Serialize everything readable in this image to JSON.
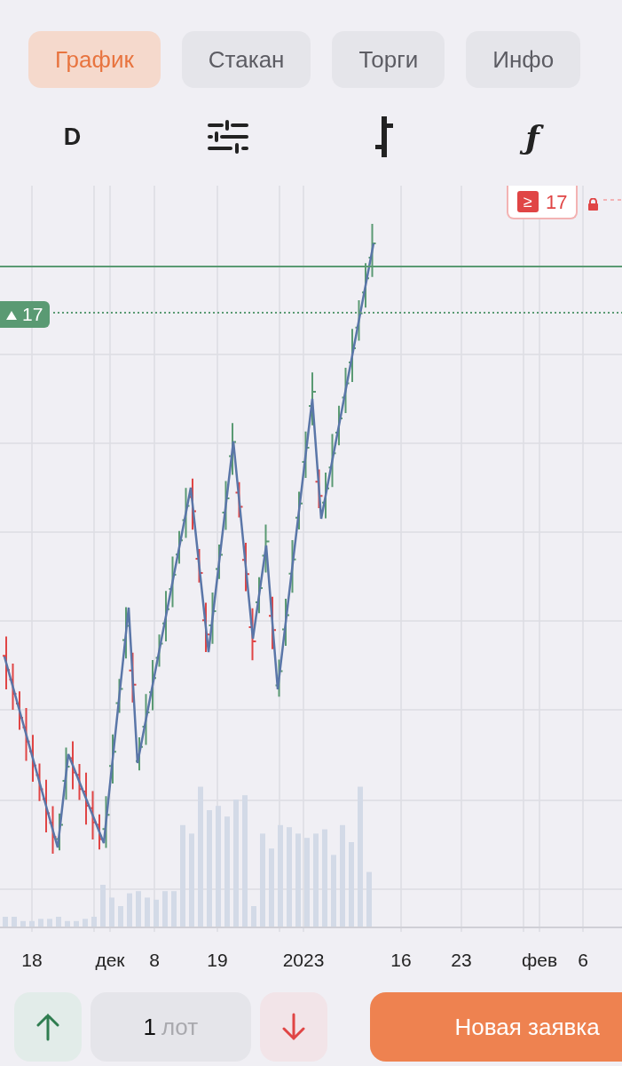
{
  "tabs": [
    {
      "label": "График",
      "selected": true
    },
    {
      "label": "Стакан",
      "selected": false
    },
    {
      "label": "Торги",
      "selected": false
    },
    {
      "label": "Инфо",
      "selected": false
    }
  ],
  "toolbar": {
    "interval": "D",
    "function": "ƒ"
  },
  "chart": {
    "last_price": {
      "text": "17",
      "rising": true
    },
    "alert": {
      "sign": "≥",
      "text": "17",
      "locked": true
    },
    "x_labels": [
      "18",
      "дек",
      "8",
      "19",
      "2023",
      "16",
      "23",
      "фев",
      "6"
    ]
  },
  "order": {
    "quantity": "1",
    "unit": "лот",
    "submit": "Новая заявка"
  }
}
